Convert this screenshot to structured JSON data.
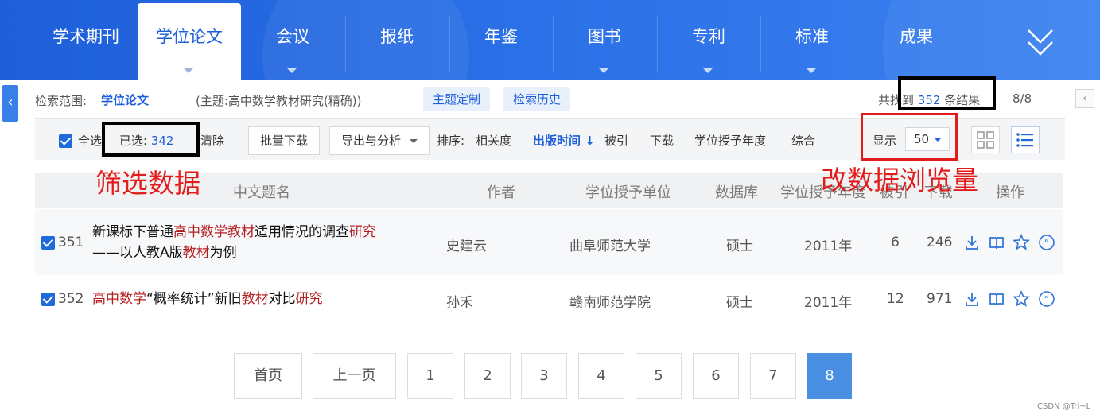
{
  "nav": {
    "tabs": [
      {
        "label": "学术期刊"
      },
      {
        "label": "学位论文"
      },
      {
        "label": "会议"
      },
      {
        "label": "报纸"
      },
      {
        "label": "年鉴"
      },
      {
        "label": "图书"
      },
      {
        "label": "专利"
      },
      {
        "label": "标准"
      },
      {
        "label": "成果"
      }
    ],
    "active_tab": "学位论文",
    "more_icon": "double-chevron-down-icon",
    "side_icon": "chevron-left-icon"
  },
  "search_info": {
    "scope_label": "检索范围:",
    "scope_value": "学位论文",
    "topic": "(主题:高中数学教材研究(精确))",
    "topic_customize_btn": "主题定制",
    "history_btn": "检索历史",
    "result_prefix": "共找到",
    "result_count": "352",
    "result_suffix": "条结果",
    "page_indicator": "8/8",
    "prev_icon": "chevron-left-icon"
  },
  "toolbar": {
    "select_all": "全选",
    "selected_label": "已选:",
    "selected_count": "342",
    "clear": "清除",
    "batch_download": "批量下载",
    "export_analysis": "导出与分析",
    "sort_label": "排序:",
    "sort_options": [
      "相关度",
      "出版时间",
      "被引",
      "下载",
      "学位授予年度",
      "综合"
    ],
    "active_sort": "出版时间",
    "display_label": "显示",
    "display_value": "50",
    "view_modes": [
      "grid-view-icon",
      "list-view-icon"
    ]
  },
  "annotations": {
    "left_note": "筛选数据",
    "right_note": "改数据浏览量",
    "colors": {
      "red": "#e31b1b",
      "black": "#000000"
    }
  },
  "table": {
    "headers": [
      "中文题名",
      "作者",
      "学位授予单位",
      "数据库",
      "学位授予年度",
      "被引",
      "下载",
      "操作"
    ],
    "rows": [
      {
        "checked": true,
        "index": "351",
        "title_line1": [
          {
            "text": "新课标下普通",
            "hl": false
          },
          {
            "text": "高中数学教材",
            "hl": true
          },
          {
            "text": "适用情况的调查",
            "hl": false
          },
          {
            "text": "研究",
            "hl": true
          }
        ],
        "title_line2": [
          {
            "text": "——以人教A版",
            "hl": false
          },
          {
            "text": "教材",
            "hl": true
          },
          {
            "text": "为例",
            "hl": false
          }
        ],
        "author": "史建云",
        "unit": "曲阜师范大学",
        "database": "硕士",
        "year": "2011年",
        "cited": "6",
        "downloads": "246"
      },
      {
        "checked": true,
        "index": "352",
        "title_line1": [
          {
            "text": "高中数学",
            "hl": true
          },
          {
            "text": "“概率统计”新旧",
            "hl": false
          },
          {
            "text": "教材",
            "hl": true
          },
          {
            "text": "对比",
            "hl": false
          },
          {
            "text": "研究",
            "hl": true
          }
        ],
        "title_line2": [],
        "author": "孙禾",
        "unit": "赣南师范学院",
        "database": "硕士",
        "year": "2011年",
        "cited": "12",
        "downloads": "971"
      }
    ],
    "row_ops": [
      "download-icon",
      "read-book-icon",
      "favorite-star-icon",
      "quote-icon"
    ]
  },
  "pagination": {
    "first": "首页",
    "prev": "上一页",
    "pages": [
      "1",
      "2",
      "3",
      "4",
      "5",
      "6",
      "7",
      "8"
    ],
    "current": "8"
  },
  "watermark": "CSDN @Tri~L",
  "colors": {
    "nav_blue": "#1e5fd9",
    "accent": "#1e5fd9",
    "highlight_red": "#b31f1f",
    "current_page": "#4a90e2"
  }
}
